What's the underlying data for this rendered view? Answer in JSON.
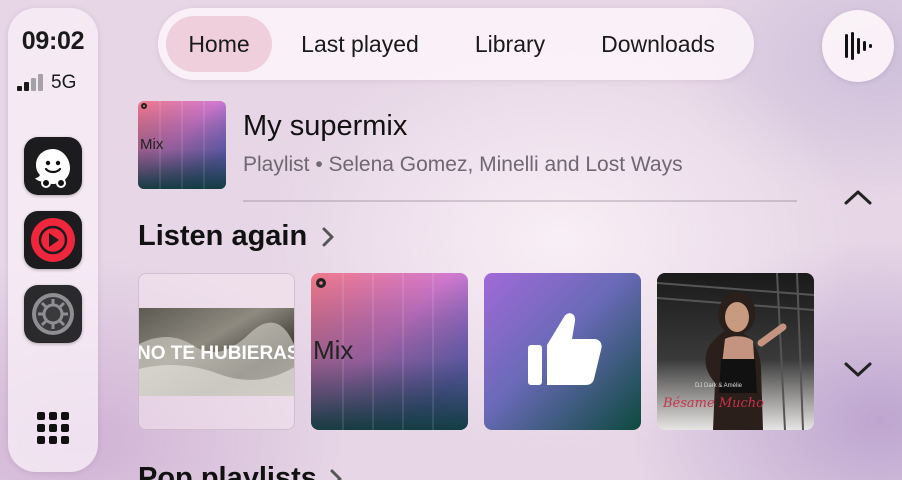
{
  "status": {
    "time": "09:02",
    "network": "5G",
    "signal_bars": 2
  },
  "dock": {
    "apps": [
      {
        "name": "Waze",
        "icon": "waze-icon"
      },
      {
        "name": "YouTube Music",
        "icon": "youtube-music-icon"
      },
      {
        "name": "Settings",
        "icon": "settings-icon"
      }
    ],
    "grid_icon": "app-grid-icon"
  },
  "tabs": [
    {
      "label": "Home",
      "active": true
    },
    {
      "label": "Last played",
      "active": false
    },
    {
      "label": "Library",
      "active": false
    },
    {
      "label": "Downloads",
      "active": false
    }
  ],
  "voice_icon": "voice-search-icon",
  "now_playing": {
    "art_label": "Mix",
    "title": "My supermix",
    "subtitle": "Playlist • Selena Gomez, Minelli and Lost Ways"
  },
  "listen_again": {
    "title": "Listen again",
    "cards": [
      {
        "kind": "video-thumb",
        "text": "NO TE HUBIERAS I"
      },
      {
        "kind": "mix",
        "text": "Mix"
      },
      {
        "kind": "liked",
        "icon": "thumbs-up-icon"
      },
      {
        "kind": "album",
        "artist": "DJ Dark & Amélie",
        "text": "Bésame Mucho"
      }
    ]
  },
  "next_section": {
    "title": "Pop playlists"
  },
  "colors": {
    "accent": "#e6b9c8",
    "text": "#1a1a1a",
    "muted": "#6f6772"
  }
}
